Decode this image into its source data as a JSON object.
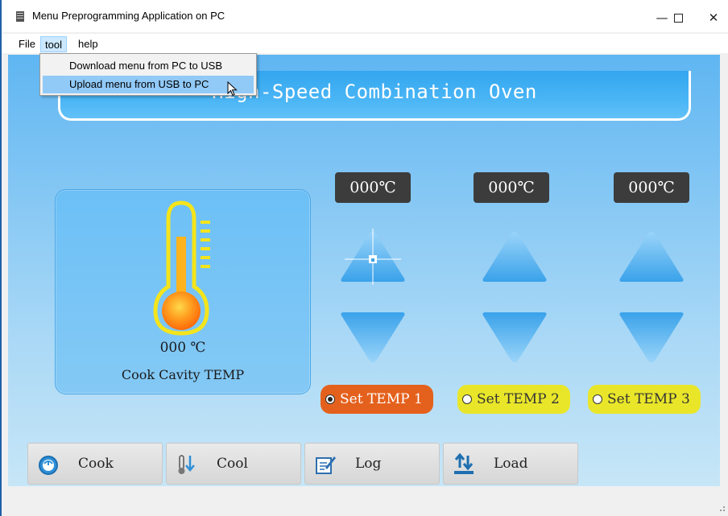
{
  "window": {
    "title": "Menu Preprogramming Application on PC",
    "controls": {
      "minimize": "—",
      "maximize": "☐",
      "close": "✕"
    }
  },
  "menubar": {
    "items": [
      {
        "label": "File"
      },
      {
        "label": "tool"
      },
      {
        "label": "help"
      }
    ],
    "open_menu": "tool"
  },
  "dropdown": {
    "items": [
      {
        "label": "Download menu from PC to USB"
      },
      {
        "label": "Upload menu from USB to PC"
      }
    ],
    "hovered_index": 1
  },
  "banner": {
    "title": "High-Speed Combination Oven"
  },
  "cavity": {
    "value": "000 ℃",
    "label": "Cook Cavity TEMP",
    "icon": "thermometer-icon"
  },
  "zones": [
    {
      "display": "000℃",
      "set_label": "Set TEMP 1",
      "selected": true
    },
    {
      "display": "000℃",
      "set_label": "Set TEMP 2",
      "selected": false
    },
    {
      "display": "000℃",
      "set_label": "Set TEMP 3",
      "selected": false
    }
  ],
  "tabs": [
    {
      "label": "Cook",
      "icon": "gauge-icon"
    },
    {
      "label": "Cool",
      "icon": "cool-icon"
    },
    {
      "label": "Log",
      "icon": "log-icon"
    },
    {
      "label": "Load",
      "icon": "load-icon"
    }
  ],
  "colors": {
    "selected_button": "#e4611d",
    "unselected_button": "#e9e62a",
    "display_bg": "#3c3c3c",
    "arrow_blue": "#3fa8ee"
  }
}
